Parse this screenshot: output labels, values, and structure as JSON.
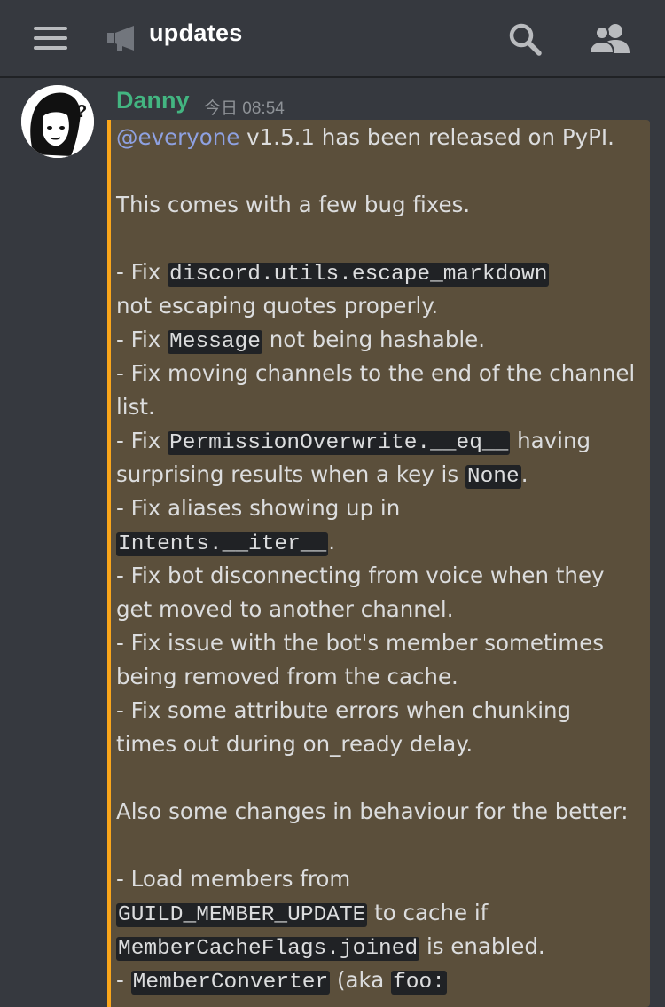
{
  "header": {
    "channel_name": "updates",
    "icons": [
      "hamburger-menu-icon",
      "announcement-channel-icon",
      "search-icon",
      "members-icon"
    ]
  },
  "message": {
    "author": "Danny",
    "timestamp": "今日 08:54",
    "author_color": "#43b581",
    "highlight_color": "#faa61a",
    "mention": "@everyone",
    "l1_rest": " v1.5.1 has been released on PyPI.",
    "l3": "This comes with a few bug fixes.",
    "l5_pre": "- Fix ",
    "l5_code": "discord.utils.escape_markdown",
    "l6": "not escaping quotes properly.",
    "l7_pre": "- Fix ",
    "l7_code": "Message",
    "l7_post": " not being hashable.",
    "l8": "- Fix moving channels to the end of the channel",
    "l9": "list.",
    "l10_pre": "- Fix ",
    "l10_code": "PermissionOverwrite.__eq__",
    "l10_post": " having",
    "l11_pre": "surprising results when a key is ",
    "l11_code": "None",
    "l11_post": ".",
    "l12": "- Fix aliases showing up in",
    "l13_code": "Intents.__iter__",
    "l13_post": ".",
    "l14": "- Fix bot disconnecting from voice when they",
    "l15": "get moved to another channel.",
    "l16": "- Fix issue with the bot's member sometimes",
    "l17": "being removed from the cache.",
    "l18": "- Fix some attribute errors when chunking",
    "l19": "times out during on_ready delay.",
    "l21": "Also some changes in behaviour for the better:",
    "l23": "- Load members from",
    "l24_code": "GUILD_MEMBER_UPDATE",
    "l24_post": " to cache if",
    "l25_code": "MemberCacheFlags.joined",
    "l25_post": " is enabled.",
    "l26_pre": "- ",
    "l26_code": "MemberConverter",
    "l26_mid": " (aka ",
    "l26_code2": "foo: "
  }
}
